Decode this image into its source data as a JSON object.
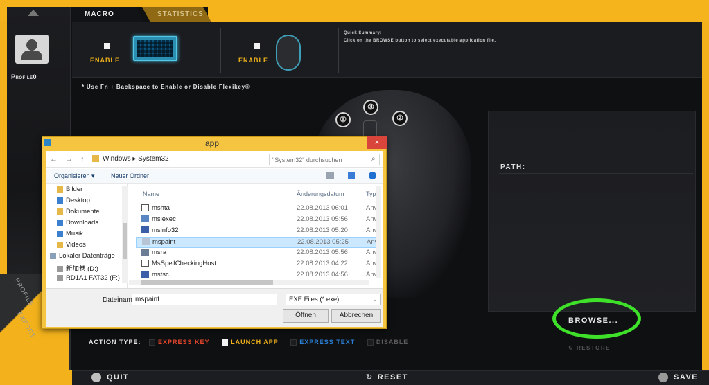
{
  "tabs": [
    {
      "label": "MACRO"
    },
    {
      "label": "STATISTICS"
    }
  ],
  "profile": {
    "label": "Profile0"
  },
  "rail_labels": [
    "PROFILE",
    "EXPORT"
  ],
  "header": {
    "enable_label_1": "ENABLE",
    "enable_label_2": "ENABLE",
    "summary_title": "Quick Summary:",
    "summary_text": "Click on the BROWSE button to select executable application file."
  },
  "hint": "* Use Fn + Backspace to Enable or Disable Flexikey®",
  "mouse_buttons": [
    "①",
    "③",
    "②"
  ],
  "right_panel": {
    "path_label": "PATH:",
    "browse_label": "BROWSE...",
    "restore_label": "RESTORE"
  },
  "action_type": {
    "label": "ACTION TYPE:",
    "options": [
      "EXPRESS KEY",
      "LAUNCH APP",
      "EXPRESS TEXT",
      "DISABLE"
    ]
  },
  "bottom": {
    "quit": "QUIT",
    "reset": "RESET",
    "save": "SAVE"
  },
  "dialog": {
    "title": "app",
    "close": "×",
    "nav": "← → ↑",
    "breadcrumb": "Windows ▸ System32",
    "search_placeholder": "\"System32\" durchsuchen",
    "toolbar_organize": "Organisieren ▾",
    "toolbar_new_folder": "Neuer Ordner",
    "nav_items": [
      "Bilder",
      "Desktop",
      "Dokumente",
      "Downloads",
      "Musik",
      "Videos",
      "Lokaler Datenträge",
      "新加卷 (D:)",
      "RD1A1 FAT32 (F:)"
    ],
    "columns": {
      "name": "Name",
      "date": "Änderungsdatum",
      "type": "Typ"
    },
    "files": [
      {
        "name": "mshta",
        "date": "22.08.2013 06:01",
        "type": "Anv"
      },
      {
        "name": "msiexec",
        "date": "22.08.2013 05:56",
        "type": "Anv"
      },
      {
        "name": "msinfo32",
        "date": "22.08.2013 05:20",
        "type": "Anv"
      },
      {
        "name": "mspaint",
        "date": "22.08.2013 05:25",
        "type": "Anv"
      },
      {
        "name": "msra",
        "date": "22.08.2013 05:56",
        "type": "Anv"
      },
      {
        "name": "MsSpellCheckingHost",
        "date": "22.08.2013 04:22",
        "type": "Anv"
      },
      {
        "name": "mstsc",
        "date": "22.08.2013 04:56",
        "type": "Anv"
      }
    ],
    "selected_index": 3,
    "filename_label": "Dateiname:",
    "filename_value": "mspaint",
    "filetype": "EXE Files (*.exe)",
    "open_button": "Öffnen",
    "cancel_button": "Abbrechen"
  }
}
